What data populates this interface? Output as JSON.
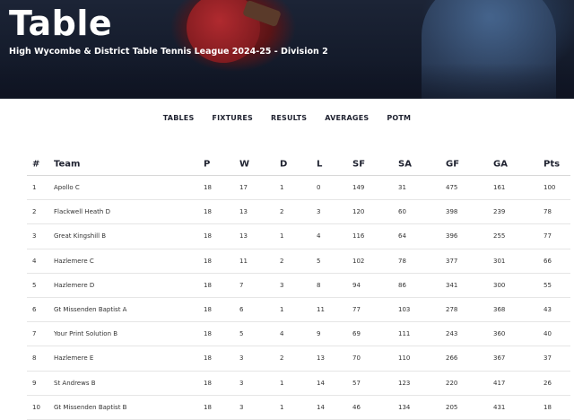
{
  "header": {
    "title": "Table",
    "subtitle": "High Wycombe & District Table Tennis League 2024-25 - Division 2"
  },
  "nav": [
    "TABLES",
    "FIXTURES",
    "RESULTS",
    "AVERAGES",
    "POTM"
  ],
  "table": {
    "headers": [
      "#",
      "Team",
      "P",
      "W",
      "D",
      "L",
      "SF",
      "SA",
      "GF",
      "GA",
      "Pts"
    ],
    "rows": [
      [
        "1",
        "Apollo C",
        "18",
        "17",
        "1",
        "0",
        "149",
        "31",
        "475",
        "161",
        "100"
      ],
      [
        "2",
        "Flackwell Heath D",
        "18",
        "13",
        "2",
        "3",
        "120",
        "60",
        "398",
        "239",
        "78"
      ],
      [
        "3",
        "Great Kingshill B",
        "18",
        "13",
        "1",
        "4",
        "116",
        "64",
        "396",
        "255",
        "77"
      ],
      [
        "4",
        "Hazlemere C",
        "18",
        "11",
        "2",
        "5",
        "102",
        "78",
        "377",
        "301",
        "66"
      ],
      [
        "5",
        "Hazlemere D",
        "18",
        "7",
        "3",
        "8",
        "94",
        "86",
        "341",
        "300",
        "55"
      ],
      [
        "6",
        "Gt Missenden Baptist A",
        "18",
        "6",
        "1",
        "11",
        "77",
        "103",
        "278",
        "368",
        "43"
      ],
      [
        "7",
        "Your Print Solution B",
        "18",
        "5",
        "4",
        "9",
        "69",
        "111",
        "243",
        "360",
        "40"
      ],
      [
        "8",
        "Hazlemere E",
        "18",
        "3",
        "2",
        "13",
        "70",
        "110",
        "266",
        "367",
        "37"
      ],
      [
        "9",
        "St Andrews B",
        "18",
        "3",
        "1",
        "14",
        "57",
        "123",
        "220",
        "417",
        "26"
      ],
      [
        "10",
        "Gt Missenden Baptist B",
        "18",
        "3",
        "1",
        "14",
        "46",
        "134",
        "205",
        "431",
        "18"
      ]
    ]
  }
}
